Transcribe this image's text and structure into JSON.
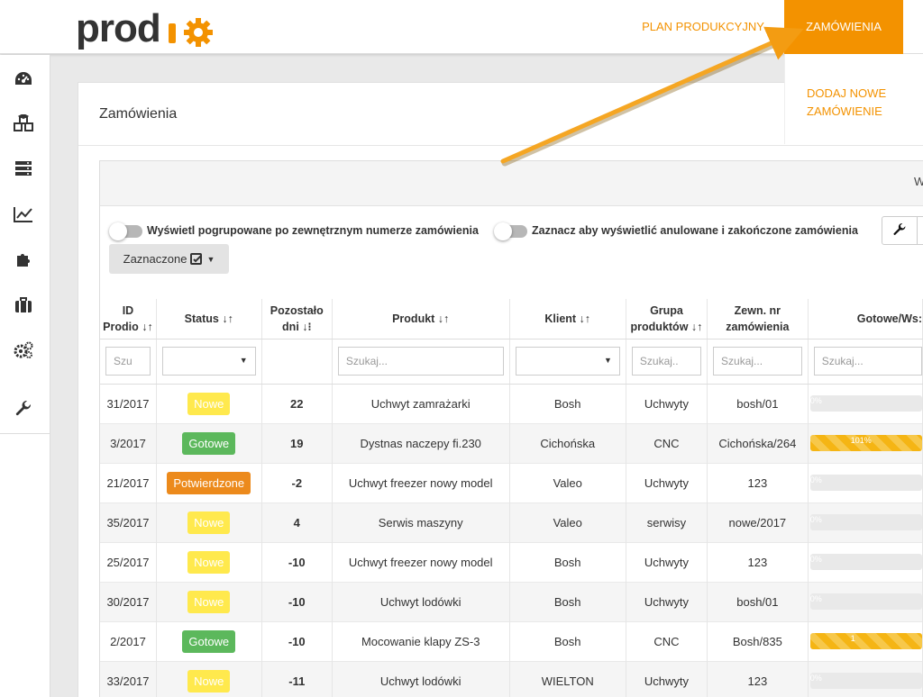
{
  "brand": {
    "accent": "#f39200",
    "logo_text": "prodio"
  },
  "topnav": {
    "plan": "PLAN PRODUKCYJNY",
    "orders": "ZAMÓWIENIA"
  },
  "dropdown": {
    "add_order": "DODAJ NOWE ZAMÓWIENIE"
  },
  "sidebar": {
    "items": [
      "dashboard-icon",
      "cubes-icon",
      "server-icon",
      "chart-icon",
      "puzzle-icon",
      "briefcase-icon",
      "cogs-icon",
      "wrench-icon"
    ]
  },
  "page": {
    "title": "Zamówienia",
    "header_right": "W"
  },
  "toggles": {
    "group_by_external": "Wyświetl pogrupowane po zewnętrznym numerze zamówienia",
    "show_cancelled": "Zaznacz aby wyświetlić anulowane i zakończone zamówienia"
  },
  "selected_button": "Zaznaczone",
  "table": {
    "headers": {
      "id": [
        "ID",
        "Prodio ↓↑"
      ],
      "status": "Status ↓↑",
      "days": [
        "Pozostało",
        "dni ↓⁝"
      ],
      "product": "Produkt ↓↑",
      "client": "Klient ↓↑",
      "group": [
        "Grupa",
        "produktów ↓↑"
      ],
      "ext": [
        "Zewn. nr",
        "zamówienia"
      ],
      "progress": "Gotowe/Ws:"
    },
    "filters": {
      "id": "Szu",
      "product": "Szukaj...",
      "group": "Szukaj..",
      "ext": "Szukaj...",
      "progress": "Szukaj..."
    },
    "rows": [
      {
        "id": "31/2017",
        "status": "Nowe",
        "status_type": "nowe",
        "days": "22",
        "days_type": "green",
        "product": "Uchwyt zamrażarki",
        "client": "Bosh",
        "group": "Uchwyty",
        "ext": "bosh/01",
        "progress_label": "0%",
        "progress": 0
      },
      {
        "id": "3/2017",
        "status": "Gotowe",
        "status_type": "gotowe",
        "days": "19",
        "days_type": "green",
        "product": "Dystnas naczepy fi.230",
        "client": "Cichońska",
        "group": "CNC",
        "ext": "Cichońska/264",
        "progress_label": "101%",
        "progress": 100
      },
      {
        "id": "21/2017",
        "status": "Potwierdzone",
        "status_type": "potw",
        "days": "-2",
        "days_type": "red",
        "product": "Uchwyt freezer nowy model",
        "client": "Valeo",
        "group": "Uchwyty",
        "ext": "123",
        "progress_label": "0%",
        "progress": 0
      },
      {
        "id": "35/2017",
        "status": "Nowe",
        "status_type": "nowe",
        "days": "4",
        "days_type": "orange",
        "product": "Serwis maszyny",
        "client": "Valeo",
        "group": "serwisy",
        "ext": "nowe/2017",
        "progress_label": "0%",
        "progress": 0
      },
      {
        "id": "25/2017",
        "status": "Nowe",
        "status_type": "nowe",
        "days": "-10",
        "days_type": "red",
        "product": "Uchwyt freezer nowy model",
        "client": "Bosh",
        "group": "Uchwyty",
        "ext": "123",
        "progress_label": "0%",
        "progress": 0
      },
      {
        "id": "30/2017",
        "status": "Nowe",
        "status_type": "nowe",
        "days": "-10",
        "days_type": "red",
        "product": "Uchwyt lodówki",
        "client": "Bosh",
        "group": "Uchwyty",
        "ext": "bosh/01",
        "progress_label": "0%",
        "progress": 0
      },
      {
        "id": "2/2017",
        "status": "Gotowe",
        "status_type": "gotowe",
        "days": "-10",
        "days_type": "red",
        "product": "Mocowanie klapy ZS-3",
        "client": "Bosh",
        "group": "CNC",
        "ext": "Bosh/835",
        "progress_label": "1",
        "progress": 100
      },
      {
        "id": "33/2017",
        "status": "Nowe",
        "status_type": "nowe",
        "days": "-11",
        "days_type": "red",
        "product": "Uchwyt lodówki",
        "client": "WIELTON",
        "group": "Uchwyty",
        "ext": "123",
        "progress_label": "0%",
        "progress": 0
      }
    ]
  }
}
